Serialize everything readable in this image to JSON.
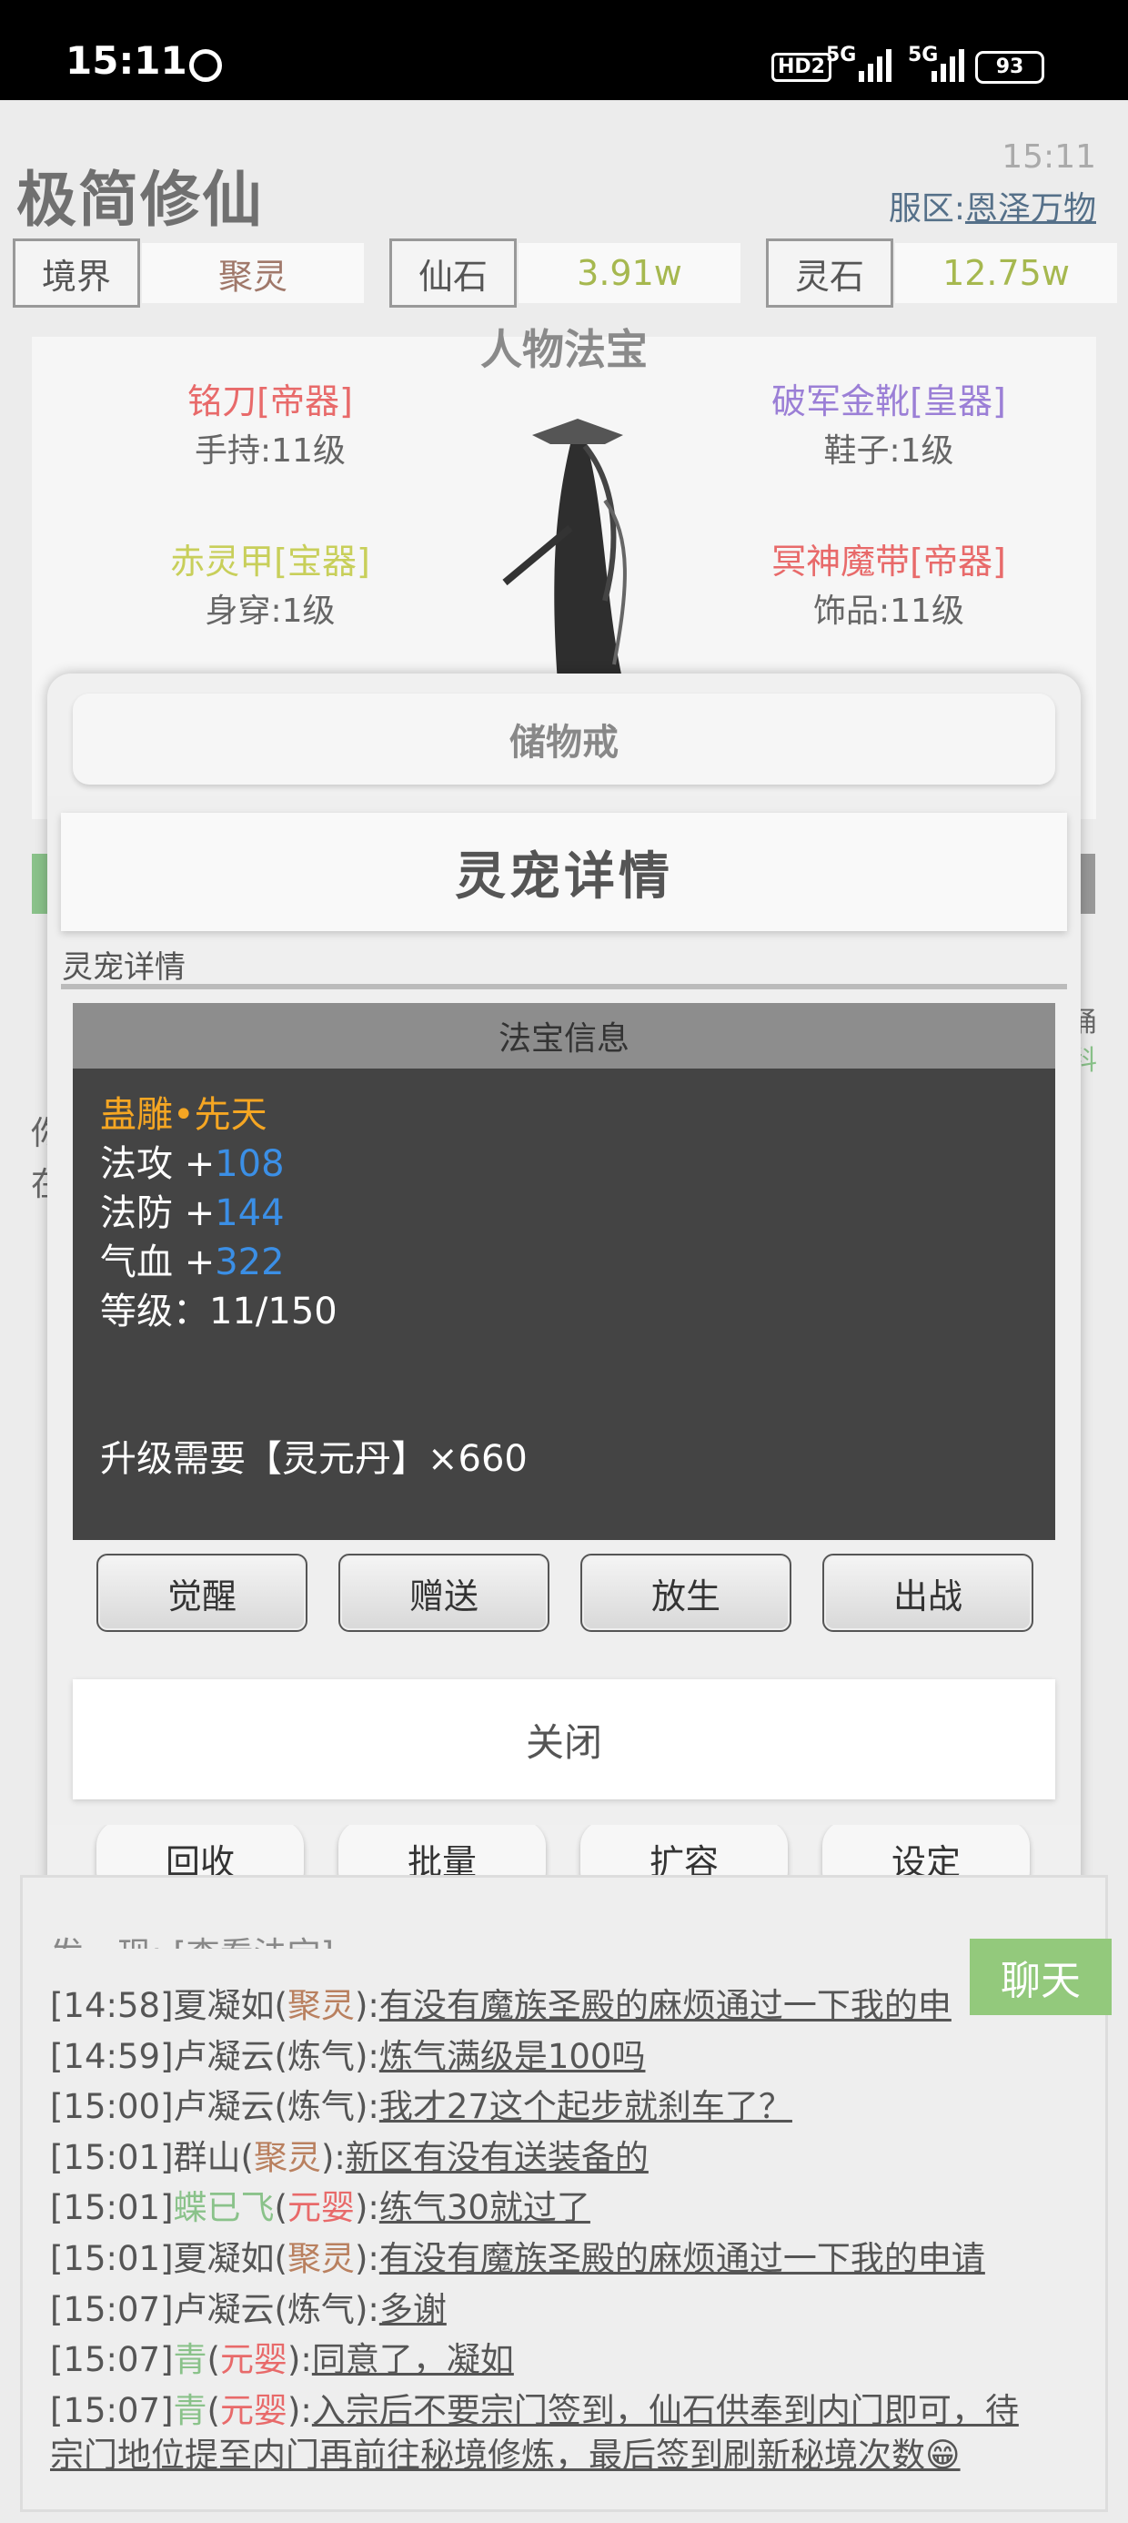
{
  "status_bar": {
    "time": "15:11",
    "hd": "HD2",
    "sig1": "5G",
    "sig2": "5G",
    "battery": "93"
  },
  "header": {
    "app_title": "极简修仙",
    "clock": "15:11",
    "server_label": "服区:",
    "server_name": "恩泽万物"
  },
  "stats": [
    {
      "label": "境界",
      "value": "聚灵",
      "color": "#a0786a"
    },
    {
      "label": "仙石",
      "value": "3.91w",
      "color": "#a6b84f"
    },
    {
      "label": "灵石",
      "value": "12.75w",
      "color": "#a6b84f"
    }
  ],
  "equipment": {
    "title": "人物法宝",
    "slots": [
      {
        "name": "铭刀[帝器]",
        "sub": "手持:11级",
        "color": "#e86a6a"
      },
      {
        "name": "破军金靴[皇器]",
        "sub": "鞋子:1级",
        "color": "#9b7fd6"
      },
      {
        "name": "赤灵甲[宝器]",
        "sub": "身穿:1级",
        "color": "#c8cf5a"
      },
      {
        "name": "冥神魔带[帝器]",
        "sub": "饰品:11级",
        "color": "#e86a6a"
      }
    ]
  },
  "storage": {
    "title": "储物戒",
    "buttons": [
      "回收",
      "批量",
      "扩容",
      "设定"
    ]
  },
  "pet": {
    "title": "灵宠详情",
    "tab": "灵宠详情",
    "info_title": "法宝信息",
    "name": "蛊雕•先天",
    "stats": [
      {
        "label": "法攻 +",
        "value": "108"
      },
      {
        "label": "法防 +",
        "value": "144"
      },
      {
        "label": "气血 +",
        "value": "322"
      }
    ],
    "level": "等级：11/150",
    "upgrade": "升级需要【灵元丹】×660",
    "buttons": [
      "觉醒",
      "赠送",
      "放生",
      "出战"
    ],
    "close": "关闭",
    "name_color": "#f5a623"
  },
  "background_fragments": {
    "left1": "你",
    "left2": "在",
    "right1": "涌",
    "right2": "科"
  },
  "chat": {
    "button": "聊天",
    "partial_line": "发一现: [查看法宝]",
    "lines": [
      {
        "time": "[14:58]",
        "name": "夏凝如",
        "rank": "聚灵",
        "msg": "有没有魔族圣殿的麻烦通过一下我的申"
      },
      {
        "time": "[14:59]",
        "name": "卢凝云",
        "rank": "炼气",
        "msg": "炼气满级是100吗"
      },
      {
        "time": "[15:00]",
        "name": "卢凝云",
        "rank": "炼气",
        "msg": "我才27这个起步就刹车了？"
      },
      {
        "time": "[15:01]",
        "name": "群山",
        "rank": "聚灵",
        "msg": "新区有没有送装备的"
      },
      {
        "time": "[15:01]",
        "name": "蝶已飞",
        "rank": "元婴",
        "msg": "练气30就过了"
      },
      {
        "time": "[15:01]",
        "name": "夏凝如",
        "rank": "聚灵",
        "msg": "有没有魔族圣殿的麻烦通过一下我的申请"
      },
      {
        "time": "[15:07]",
        "name": "卢凝云",
        "rank": "炼气",
        "msg": "多谢"
      },
      {
        "time": "[15:07]",
        "name": "青",
        "rank": "元婴",
        "msg": "同意了，凝如"
      },
      {
        "time": "[15:07]",
        "name": "青",
        "rank": "元婴",
        "msg": "入宗后不要宗门签到，仙石供奉到内门即可，待"
      }
    ],
    "continuation": "宗门地位提至内门再前往秘境修炼，最后签到刷新秘境次数😁"
  }
}
